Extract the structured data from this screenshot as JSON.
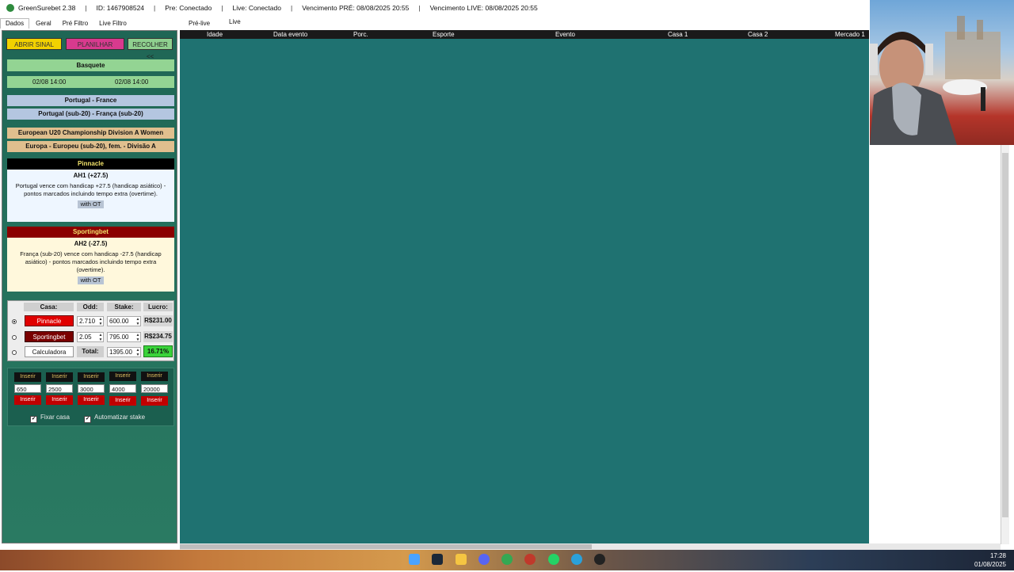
{
  "titlebar": {
    "app_title": "GreenSurebet 2.38",
    "id_text": "ID: 1467908524",
    "pre_status": "Pre: Conectado",
    "live_status": "Live: Conectado",
    "pre_expiry": "Vencimento PRÉ: 08/08/2025 20:55",
    "live_expiry": "Vencimento LIVE: 08/08/2025 20:55"
  },
  "menu": {
    "items": [
      "Dados",
      "Geral",
      "Pré Filtro",
      "Live Filtro"
    ],
    "subtabs": [
      "Pré-live",
      "Live"
    ]
  },
  "controls": {
    "open_signal": "ABRIR SINAL",
    "spreadsheet": "PLANILHAR",
    "collapse": "RECOLHER <<"
  },
  "event": {
    "sport": "Basquete",
    "date1": "02/08 14:00",
    "date2": "02/08 14:00",
    "match1": "Portugal - France",
    "match2": "Portugal (sub-20) - França (sub-20)",
    "league1": "European U20 Championship Division A Women",
    "league2": "Europa - Europeu (sub-20), fem. - Divisão A"
  },
  "bet1": {
    "house": "Pinnacle",
    "market": "AH1 (+27.5)",
    "description": "Portugal vence com handicap +27.5 (handicap asiático) - pontos marcados incluindo tempo extra (overtime).",
    "tag": "with OT"
  },
  "bet2": {
    "house": "Sportingbet",
    "market": "AH2 (-27.5)",
    "description": "França (sub-20) vence com handicap -27.5 (handicap asiático) - pontos marcados incluindo tempo extra (overtime).",
    "tag": "with OT"
  },
  "calculator": {
    "headers": [
      "Casa:",
      "Odd:",
      "Stake:",
      "Lucro:"
    ],
    "rows": [
      {
        "house": "Pinnacle",
        "odd": "2.710",
        "stake": "600.00",
        "profit": "R$231.00"
      },
      {
        "house": "Sportingbet",
        "odd": "2.05",
        "stake": "795.00",
        "profit": "R$234.75"
      }
    ],
    "calc_label": "Calculadora",
    "total_label": "Total:",
    "total_value": "1395.00",
    "percent": "16.71%"
  },
  "quick_stakes": {
    "insert_label": "Inserir",
    "values": [
      "650",
      "2500",
      "3000",
      "4000",
      "20000"
    ],
    "fix_house": "Fixar casa",
    "auto_stake": "Automatizar stake"
  },
  "table": {
    "columns": [
      "Idade",
      "Data evento",
      "Porc.",
      "Esporte",
      "Evento",
      "Casa 1",
      "Casa 2",
      "Mercado 1"
    ]
  },
  "tray": {
    "time": "17:28",
    "date": "01/08/2025"
  },
  "colors": {
    "main_bg": "#1f7271",
    "panel_bg": "#24705c",
    "pinnacle": "#e00000",
    "sportingbet": "#8b0000",
    "percent_bg": "#39d339"
  }
}
